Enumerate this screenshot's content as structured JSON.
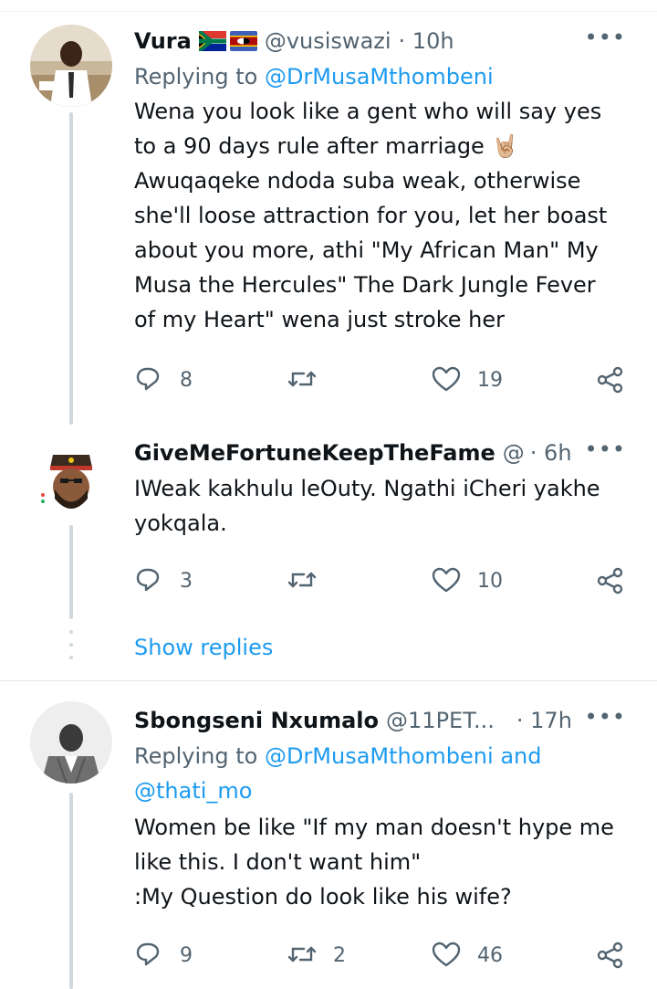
{
  "tweets": [
    {
      "name": "Vura",
      "handle": "@vusiswazi",
      "time": "· 10h",
      "replying_prefix": "Replying to ",
      "replying_to": "@DrMusaMthombeni",
      "lines": [
        "Wena you look like a gent who will say yes",
        "to a 90 days rule after marriage 🤘🏼",
        "Awuqaqeke ndoda suba weak, otherwise",
        "she'll loose attraction for you, let her boast",
        "about you more, athi \"My African Man\" My",
        "Musa the Hercules\" The Dark Jungle Fever",
        "of my Heart\" wena just stroke her"
      ],
      "replies": "8",
      "retweets": "",
      "likes": "19"
    },
    {
      "name": "GiveMeFortuneKeepTheFame",
      "handle": "@",
      "time": "· 6h",
      "lines": [
        "IWeak kakhulu leOuty. Ngathi iCheri yakhe",
        "yokqala."
      ],
      "replies": "3",
      "retweets": "",
      "likes": "10"
    },
    {
      "name": "Sbongseni Nxumalo",
      "handle": "@11PET...",
      "time": "· 17h",
      "replying_prefix": "Replying to ",
      "replying_to": "@DrMusaMthombeni and",
      "replying_to_2": "@thati_mo",
      "lines": [
        "Women be like \"If my man doesn't hype me",
        "like this. I don't want him\"",
        ":My Question do look like his wife?"
      ],
      "replies": "9",
      "retweets": "2",
      "likes": "46"
    }
  ],
  "show_replies": "Show replies",
  "more_glyph": "•••",
  "colors": {
    "accent": "#1d9bf0",
    "muted": "#536471",
    "line": "#cfd9de"
  },
  "icons": [
    "reply-icon",
    "retweet-icon",
    "like-icon",
    "share-icon",
    "more-icon"
  ]
}
